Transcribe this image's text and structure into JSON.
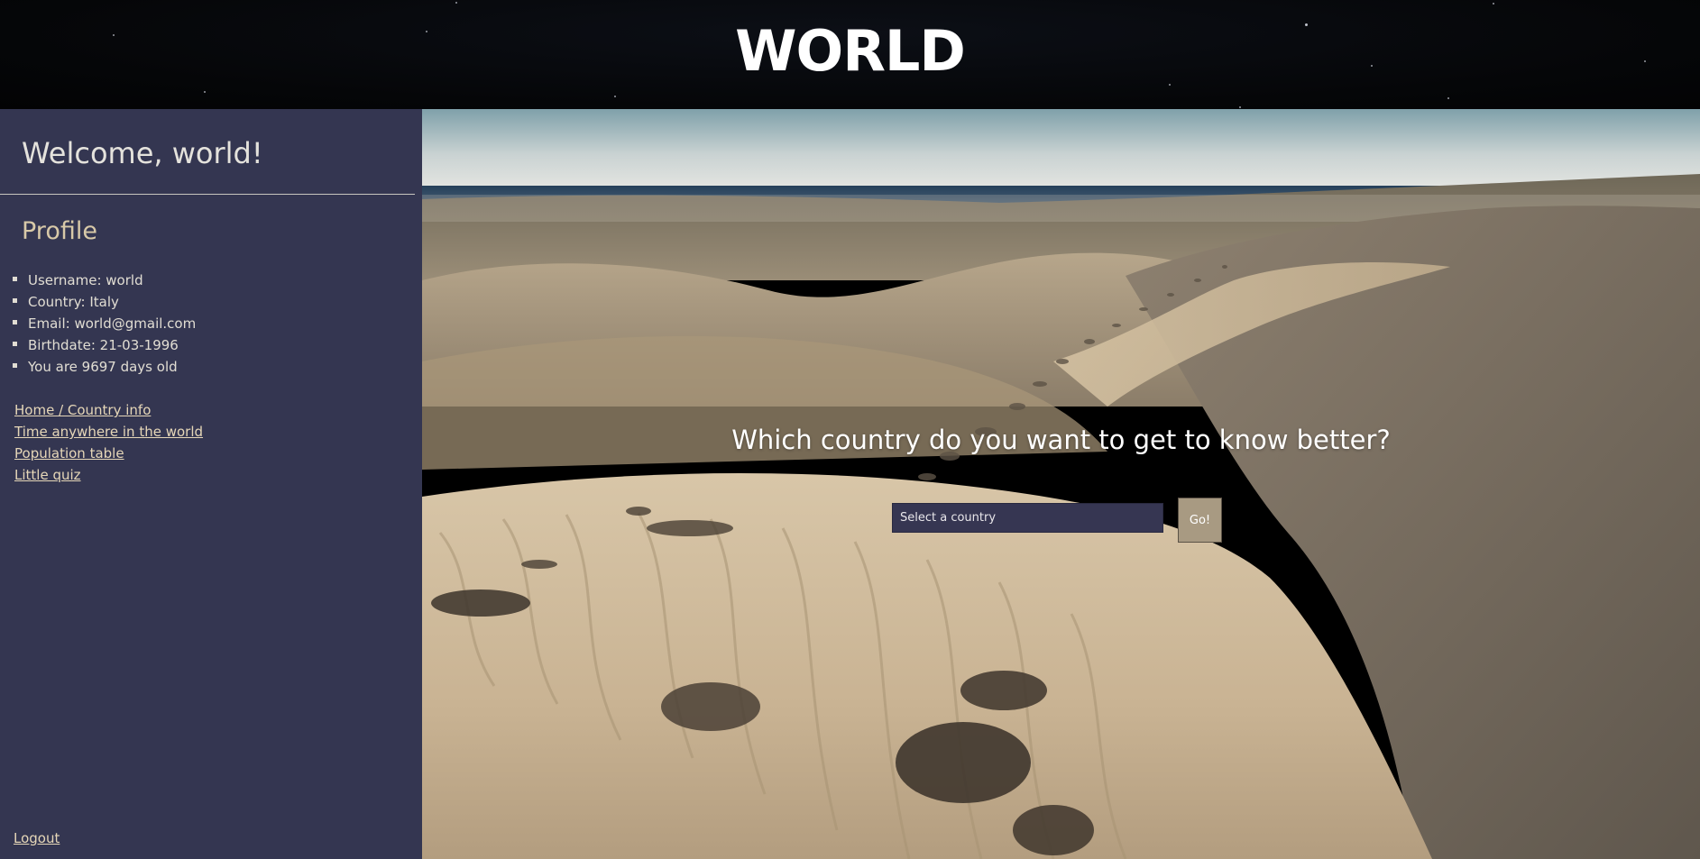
{
  "header": {
    "title": "WORLD"
  },
  "sidebar": {
    "welcome": "Welcome, world!",
    "profile_heading": "Profile",
    "profile_items": [
      "Username: world",
      "Country: Italy",
      "Email: world@gmail.com",
      "Birthdate: 21-03-1996",
      "You are 9697 days old"
    ],
    "nav_links": [
      "Home / Country info",
      "Time anywhere in the world",
      "Population table",
      "Little quiz"
    ],
    "logout": "Logout"
  },
  "main": {
    "question": "Which country do you want to get to know better?",
    "country_select": {
      "selected": "Select a country"
    },
    "go_button": "Go!"
  },
  "colors": {
    "sidebar_bg": "#343651",
    "header_bg": "#050608",
    "link": "#e6d7b8",
    "profile_heading": "#d8c9a8",
    "go_button_bg": "#a89a82",
    "select_bg": "#363652"
  }
}
